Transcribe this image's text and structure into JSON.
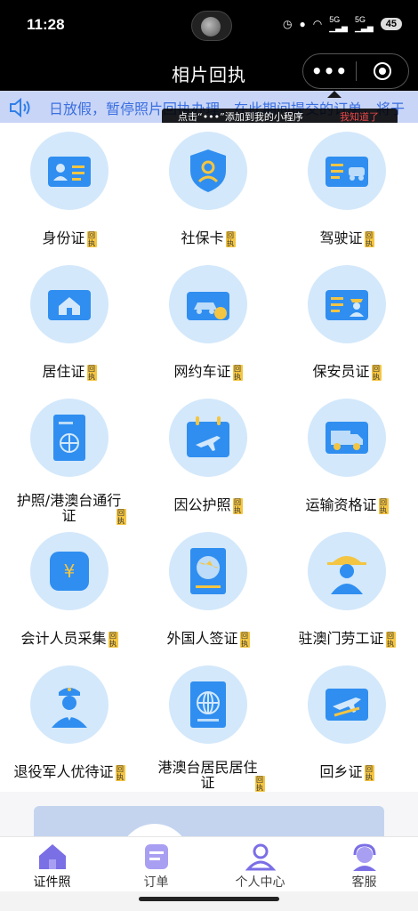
{
  "status_bar": {
    "time": "11:28",
    "network_1": "5G",
    "network_2": "5G",
    "battery": "45"
  },
  "header": {
    "title": "相片回执",
    "more_label": "•••",
    "close_icon": "record-icon"
  },
  "notice": {
    "text": "日放假，暂停照片回执办理。在此期间提交的订单，将于",
    "tip_text": "点击“•••”添加到我的小程序",
    "tip_button": "我知道了"
  },
  "badge_text": "回执",
  "services": [
    {
      "label": "身份证",
      "icon": "id-card-icon"
    },
    {
      "label": "社保卡",
      "icon": "social-security-shield-icon"
    },
    {
      "label": "驾驶证",
      "icon": "driving-license-icon"
    },
    {
      "label": "居住证",
      "icon": "residence-permit-icon"
    },
    {
      "label": "网约车证",
      "icon": "ride-hailing-car-icon"
    },
    {
      "label": "保安员证",
      "icon": "security-guard-card-icon"
    },
    {
      "label": "护照/港澳台通行证",
      "icon": "passport-icon"
    },
    {
      "label": "因公护照",
      "icon": "official-passport-calendar-icon"
    },
    {
      "label": "运输资格证",
      "icon": "transport-truck-icon"
    },
    {
      "label": "会计人员采集",
      "icon": "accountant-yen-icon"
    },
    {
      "label": "外国人签证",
      "icon": "foreigner-visa-icon"
    },
    {
      "label": "驻澳门劳工证",
      "icon": "macau-worker-icon"
    },
    {
      "label": "退役军人优待证",
      "icon": "veteran-icon"
    },
    {
      "label": "港澳台居民居住证",
      "icon": "globe-passport-icon"
    },
    {
      "label": "回乡证",
      "icon": "return-home-plane-icon"
    }
  ],
  "tabs": [
    {
      "label": "证件照",
      "icon": "home-icon",
      "active": true
    },
    {
      "label": "订单",
      "icon": "order-icon",
      "active": false
    },
    {
      "label": "个人中心",
      "icon": "user-icon",
      "active": false
    },
    {
      "label": "客服",
      "icon": "customer-service-icon",
      "active": false
    }
  ],
  "colors": {
    "accent": "#2f8ef0",
    "icon_circle": "#d3e8fb",
    "badge": "#f4c542",
    "tab_icon": "#7b6fe6",
    "notice_bg": "#c9d5f7",
    "notice_text": "#3b6fe0"
  }
}
